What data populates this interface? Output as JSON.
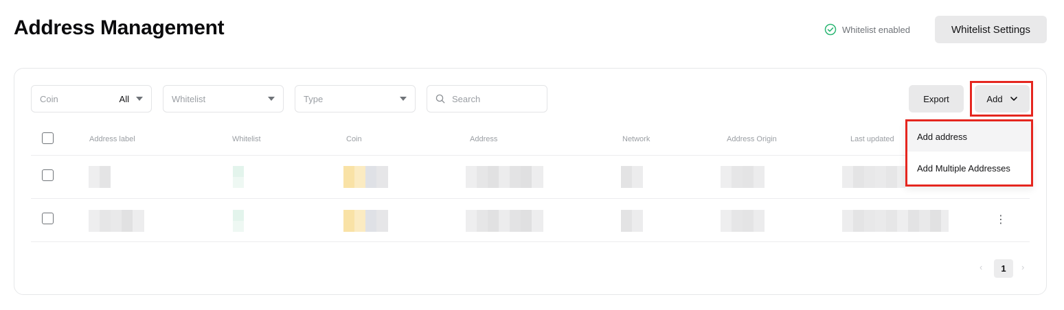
{
  "header": {
    "title": "Address Management",
    "whitelist_status": "Whitelist enabled",
    "settings_button": "Whitelist Settings"
  },
  "filters": {
    "coin": {
      "label": "Coin",
      "value": "All"
    },
    "whitelist": {
      "placeholder": "Whitelist"
    },
    "type": {
      "placeholder": "Type"
    },
    "search": {
      "placeholder": "Search"
    }
  },
  "actions": {
    "export": "Export",
    "add": "Add"
  },
  "add_menu": {
    "items": [
      "Add address",
      "Add Multiple Addresses"
    ]
  },
  "table": {
    "columns": [
      "Address label",
      "Whitelist",
      "Coin",
      "Address",
      "Network",
      "Address Origin",
      "Last updated"
    ]
  },
  "pagination": {
    "current_page": "1",
    "prev": "‹",
    "next": "›"
  },
  "colors": {
    "accent_highlight": "#e5261f",
    "status_green": "#2bb673",
    "button_bg": "#e9e9ea"
  },
  "icons": {
    "status": "check-circle-icon",
    "dropdown": "caret-down-icon",
    "search": "search-icon",
    "add_chevron": "chevron-down-icon",
    "row_menu": "more-vertical-icon"
  }
}
